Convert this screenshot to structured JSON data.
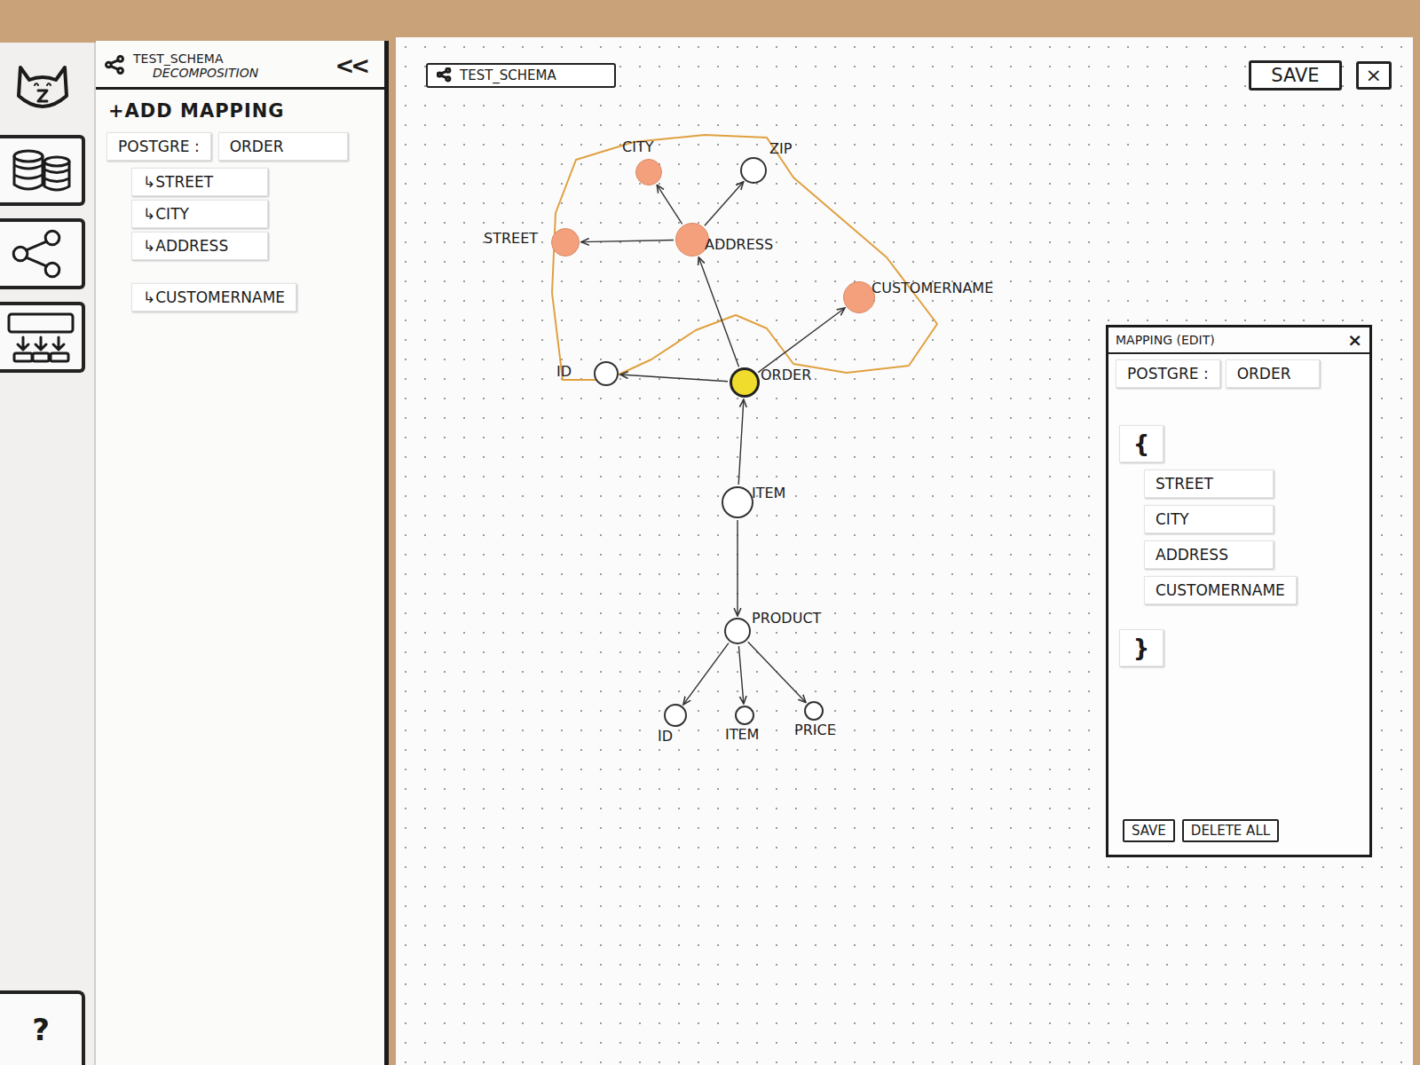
{
  "rail": {
    "help": "?"
  },
  "panel": {
    "title": "TEST_SCHEMA",
    "subtitle": "DECOMPOSITION",
    "collapse": "<<",
    "add_mapping": "+ADD MAPPING",
    "mappings": [
      {
        "source": "POSTGRE :",
        "target": "ORDER",
        "marker": "↳",
        "children": [
          "STREET",
          "CITY",
          "ADDRESS",
          "CUSTOMERNAME"
        ]
      }
    ]
  },
  "canvas": {
    "title": "TEST_SCHEMA",
    "save": "SAVE",
    "close": "×"
  },
  "graph": {
    "nodes": [
      {
        "label": "CITY",
        "color": "#f4a07c"
      },
      {
        "label": "ZIP",
        "color": "#ffffff"
      },
      {
        "label": "STREET",
        "color": "#f4a07c"
      },
      {
        "label": "ADDRESS",
        "color": "#f4a07c"
      },
      {
        "label": "CUSTOMERNAME",
        "color": "#f4a07c"
      },
      {
        "label": "ID",
        "color": "#ffffff"
      },
      {
        "label": "ORDER",
        "color": "#f0dc2c"
      },
      {
        "label": "ITEM",
        "color": "#ffffff"
      },
      {
        "label": "PRODUCT",
        "color": "#ffffff"
      },
      {
        "label": "ID",
        "color": "#ffffff"
      },
      {
        "label": "ITEM",
        "color": "#ffffff"
      },
      {
        "label": "PRICE",
        "color": "#ffffff"
      }
    ],
    "edges": [
      {
        "from": 3,
        "to": 0
      },
      {
        "from": 3,
        "to": 1
      },
      {
        "from": 3,
        "to": 2
      },
      {
        "from": 6,
        "to": 3
      },
      {
        "from": 6,
        "to": 4
      },
      {
        "from": 6,
        "to": 5
      },
      {
        "from": 7,
        "to": 6
      },
      {
        "from": 7,
        "to": 8
      },
      {
        "from": 8,
        "to": 9
      },
      {
        "from": 8,
        "to": 10
      },
      {
        "from": 8,
        "to": 11
      }
    ]
  },
  "dialog": {
    "title": "MAPPING (EDIT)",
    "close": "×",
    "source": "POSTGRE :",
    "target": "ORDER",
    "open_brace": "{",
    "fields": [
      "STREET",
      "CITY",
      "ADDRESS",
      "CUSTOMERNAME"
    ],
    "close_brace": "}",
    "buttons": [
      "SAVE",
      "DELETE ALL"
    ]
  }
}
